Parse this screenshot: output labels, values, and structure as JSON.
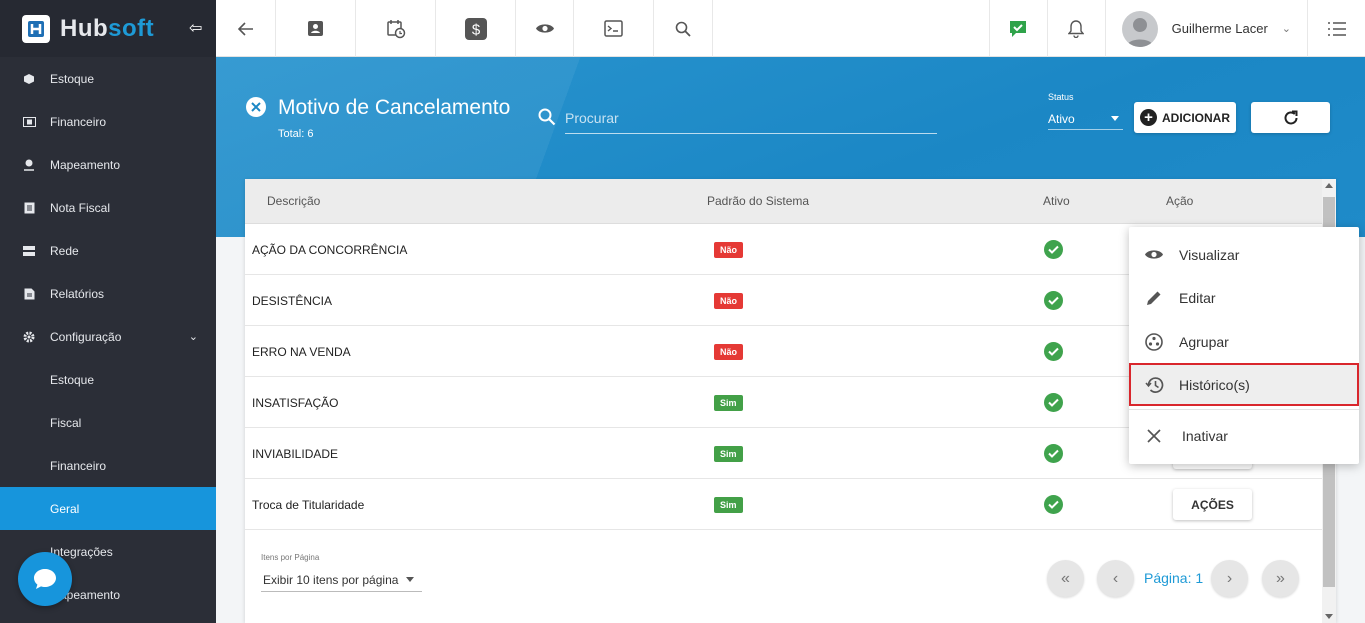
{
  "brand": {
    "logo_text_a": "Hub",
    "logo_text_b": "soft"
  },
  "sidebar": {
    "items": [
      {
        "label": "Estoque"
      },
      {
        "label": "Financeiro"
      },
      {
        "label": "Mapeamento"
      },
      {
        "label": "Nota Fiscal"
      },
      {
        "label": "Rede"
      },
      {
        "label": "Relatórios"
      },
      {
        "label": "Configuração"
      }
    ],
    "sub_items": [
      {
        "label": "Estoque"
      },
      {
        "label": "Fiscal"
      },
      {
        "label": "Financeiro"
      },
      {
        "label": "Geral"
      },
      {
        "label": "Integrações"
      },
      {
        "label": "Mapeamento"
      }
    ]
  },
  "topbar": {
    "user_name": "Guilherme Lacer"
  },
  "page": {
    "title": "Motivo de Cancelamento",
    "total": "Total: 6",
    "search_placeholder": "Procurar",
    "status_label": "Status",
    "status_value": "Ativo",
    "add_label": "ADICIONAR"
  },
  "table": {
    "headers": [
      "Descrição",
      "Padrão do Sistema",
      "Ativo",
      "Ação"
    ],
    "rows": [
      {
        "descricao": "AÇÃO DA CONCORRÊNCIA",
        "padrao": "Não"
      },
      {
        "descricao": "DESISTÊNCIA",
        "padrao": "Não"
      },
      {
        "descricao": "ERRO NA VENDA",
        "padrao": "Não"
      },
      {
        "descricao": "INSATISFAÇÃO",
        "padrao": "Sim"
      },
      {
        "descricao": "INVIABILIDADE",
        "padrao": "Sim"
      },
      {
        "descricao": "Troca de Titularidade",
        "padrao": "Sim"
      }
    ],
    "action_label": "AÇÕES"
  },
  "pagination": {
    "per_page_label": "Itens por Página",
    "per_page_value": "Exibir 10 itens por página",
    "page_label": "Página: 1"
  },
  "menu": {
    "items": [
      {
        "label": "Visualizar",
        "icon": "eye-icon"
      },
      {
        "label": "Editar",
        "icon": "pencil-icon"
      },
      {
        "label": "Agrupar",
        "icon": "group-icon"
      },
      {
        "label": "Histórico(s)",
        "icon": "history-icon"
      },
      {
        "label": "Inativar",
        "icon": "close-icon"
      }
    ]
  },
  "colors": {
    "accent": "#1795dc",
    "sidebar": "#2b2e37",
    "highlight": "#d9262c",
    "check": "#3fa34d"
  }
}
